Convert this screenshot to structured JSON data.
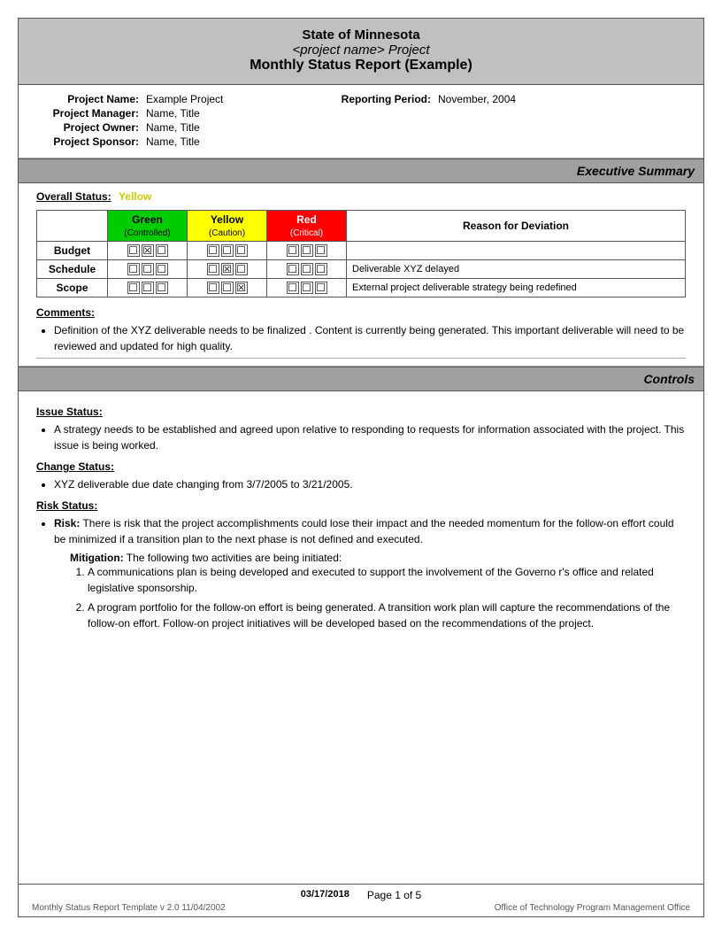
{
  "header": {
    "line1": "State of Minnesota",
    "line2": "<project name> Project",
    "line3": "Monthly Status Report (Example)"
  },
  "project_info": {
    "project_name_label": "Project Name:",
    "project_name_value": "Example Project",
    "reporting_period_label": "Reporting Period:",
    "reporting_period_value": "November, 2004",
    "project_manager_label": "Project Manager:",
    "project_manager_value": "Name, Title",
    "project_owner_label": "Project Owner:",
    "project_owner_value": "Name, Title",
    "project_sponsor_label": "Project Sponsor:",
    "project_sponsor_value": "Name, Title"
  },
  "executive_summary": {
    "section_title": "Executive Summary",
    "overall_status_label": "Overall Status:",
    "overall_status_value": "Yellow",
    "table": {
      "col_headers": [
        "Green\n(Controlled)",
        "Yellow\n(Caution)",
        "Red\n(Critical)",
        "Reason for Deviation"
      ],
      "rows": [
        {
          "label": "Budget",
          "green": [
            false,
            true,
            false
          ],
          "yellow": [
            false,
            false,
            false
          ],
          "red": [
            false,
            false,
            false
          ],
          "reason": ""
        },
        {
          "label": "Schedule",
          "green": [
            false,
            false,
            false
          ],
          "yellow": [
            false,
            true,
            false
          ],
          "red": [
            false,
            false,
            false
          ],
          "reason": "Deliverable XYZ delayed"
        },
        {
          "label": "Scope",
          "green": [
            false,
            false,
            false
          ],
          "yellow": [
            false,
            false,
            true
          ],
          "red": [
            false,
            false,
            false
          ],
          "reason": "External project deliverable strategy being redefined"
        }
      ]
    },
    "comments_label": "Comments:",
    "comments": [
      "Definition of the XYZ deliverable  needs to be finalized .  Content is currently being generated.  This important deliverable will need to be reviewed and updated for high quality."
    ]
  },
  "controls": {
    "section_title": "Controls",
    "issue_status_label": "Issue Status:",
    "issue_items": [
      "A strategy needs to be established and agreed upon relative to  responding to  requests for information associated with the project.  This issue is being worked."
    ],
    "change_status_label": "Change Status:",
    "change_items": [
      "XYZ  deliverable due date changing from   3/7/2005 to 3/21/2005."
    ],
    "risk_status_label": "Risk Status:",
    "risk_bold": "Risk:",
    "risk_text": " There is risk that the project accomplishments could lose their impact and the needed momentum for the follow-on effort could be   minimized if a transition plan to the next phase is not defined and executed.",
    "mitigation_bold": "Mitigation:",
    "mitigation_text": "  The following two activities are being initiated:",
    "mitigation_items": [
      "A communications plan is being developed and executed to support the involvement of the Governo r's office and related legislative sponsorship.",
      "A program portfolio for the follow-on effort is being generated. A transition work plan will capture the recommendations of the follow-on effort. Follow-on project initiatives will be developed based on the recommendations of the project."
    ]
  },
  "footer": {
    "date": "03/17/2018",
    "page_info": "Page 1 of 5",
    "template_info": "Monthly Status Report Template  v 2.0  11/04/2002",
    "office_info": "Office of Technology Program Management Office"
  }
}
